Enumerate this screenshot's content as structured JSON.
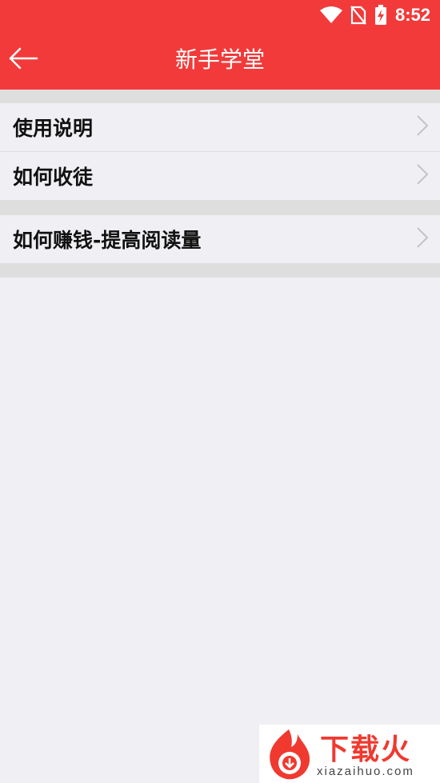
{
  "status_bar": {
    "time": "8:52",
    "icons": [
      "wifi-icon",
      "no-sim-icon",
      "battery-charging-icon"
    ]
  },
  "header": {
    "title": "新手学堂",
    "back_icon": "arrow-left-icon"
  },
  "menu": {
    "group1": [
      {
        "label": "使用说明",
        "icon": "chevron-right-icon"
      },
      {
        "label": "如何收徒",
        "icon": "chevron-right-icon"
      }
    ],
    "group2": [
      {
        "label": "如何赚钱-提高阅读量",
        "icon": "chevron-right-icon"
      }
    ]
  },
  "watermark": {
    "logo_text": "下载火",
    "url": "xiazaihuo.com"
  },
  "colors": {
    "brand_red": "#f23a3a",
    "background": "#efeff4",
    "divider": "#dededf"
  }
}
